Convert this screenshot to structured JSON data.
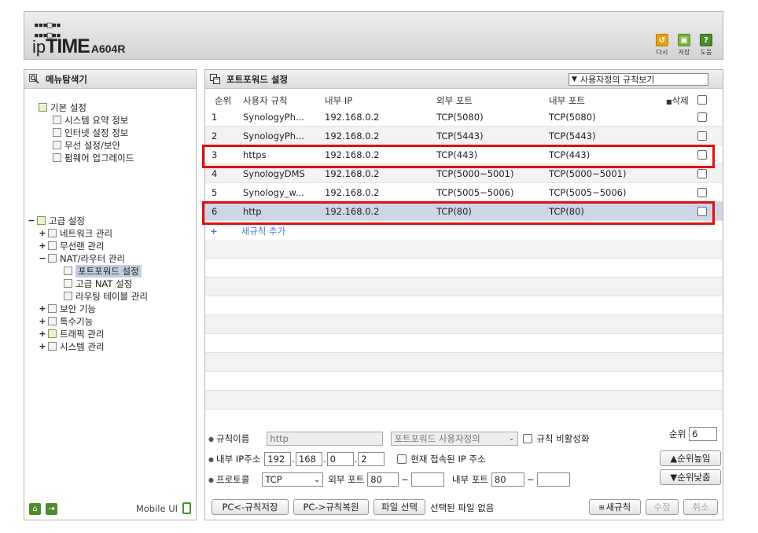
{
  "header": {
    "brand_logo": "ipTIME",
    "model": "A604R",
    "buttons": [
      {
        "label": "다시",
        "icon": "refresh-icon",
        "color": "#e3a21a"
      },
      {
        "label": "저장",
        "icon": "save-icon",
        "color": "#7cb342"
      },
      {
        "label": "도움",
        "icon": "help-icon",
        "color": "#4e8b2a"
      }
    ]
  },
  "left_panel": {
    "title": "메뉴탐색기",
    "basic": {
      "label": "기본 설정",
      "items": [
        "시스템 요약 정보",
        "인터넷 설정 정보",
        "무선 설정/보안",
        "펌웨어 업그레이드"
      ]
    },
    "advanced": {
      "sign": "−",
      "label": "고급 설정",
      "items": [
        {
          "sign": "+",
          "label": "네트워크 관리"
        },
        {
          "sign": "+",
          "label": "무선랜 관리"
        },
        {
          "sign": "−",
          "label": "NAT/라우터 관리"
        }
      ],
      "nat_children": [
        "포트포워드 설정",
        "고급 NAT 설정",
        "라우팅 테이블 관리"
      ],
      "more": [
        {
          "sign": "+",
          "label": "보안 기능"
        },
        {
          "sign": "+",
          "label": "특수기능"
        },
        {
          "sign": "+",
          "label": "트래픽 관리"
        },
        {
          "sign": "+",
          "label": "시스템 관리"
        }
      ]
    },
    "footer": {
      "mobile_label": "Mobile UI"
    }
  },
  "right_panel": {
    "title": "포트포워드 설정",
    "view_select": "사용자정의 규칙보기",
    "columns": {
      "num": "순위",
      "name": "사용자 규칙",
      "internal_ip": "내부 IP",
      "external_port": "외부 포트",
      "internal_port": "내부 포트",
      "delete": "삭제"
    },
    "rows": [
      {
        "num": "1",
        "name": "SynologyPh...",
        "ip": "192.168.0.2",
        "ext": "TCP(5080)",
        "int": "TCP(5080)"
      },
      {
        "num": "2",
        "name": "SynologyPh...",
        "ip": "192.168.0.2",
        "ext": "TCP(5443)",
        "int": "TCP(5443)"
      },
      {
        "num": "3",
        "name": "https",
        "ip": "192.168.0.2",
        "ext": "TCP(443)",
        "int": "TCP(443)"
      },
      {
        "num": "4",
        "name": "SynologyDMS",
        "ip": "192.168.0.2",
        "ext": "TCP(5000~5001)",
        "int": "TCP(5000~5001)"
      },
      {
        "num": "5",
        "name": "Synology_w...",
        "ip": "192.168.0.2",
        "ext": "TCP(5005~5006)",
        "int": "TCP(5005~5006)"
      },
      {
        "num": "6",
        "name": "http",
        "ip": "192.168.0.2",
        "ext": "TCP(80)",
        "int": "TCP(80)"
      }
    ],
    "add_rule": {
      "plus": "+",
      "label": "새규칙 추가"
    },
    "form": {
      "rule_name_label": "규칙이름",
      "rule_name_value": "http",
      "preset_select": "포트포워드 사용자정의",
      "disable_label": "규칙 비활성화",
      "order_label": "순위",
      "order_value": "6",
      "ip_label": "내부 IP주소",
      "ip_parts": [
        "192",
        "168",
        "0",
        "2"
      ],
      "current_ip_label": "현재 접속된 IP 주소",
      "order_up": "▲순위높임",
      "order_down": "▼순위낮춤",
      "protocol_label": "프로토콜",
      "protocol_value": "TCP",
      "ext_port_label": "외부 포트",
      "ext_port_from": "80",
      "ext_port_to": "",
      "int_port_label": "내부 포트",
      "int_port_from": "80",
      "int_port_to": "",
      "tilde": "~"
    },
    "footer_buttons": {
      "save_to_pc": "PC<-규칙저장",
      "restore_from_pc": "PC->규칙복원",
      "file_select": "파일 선택",
      "no_file": "선택된 파일 없음",
      "new_rule": "새규칙",
      "modify": "수정",
      "cancel": "취소"
    }
  }
}
